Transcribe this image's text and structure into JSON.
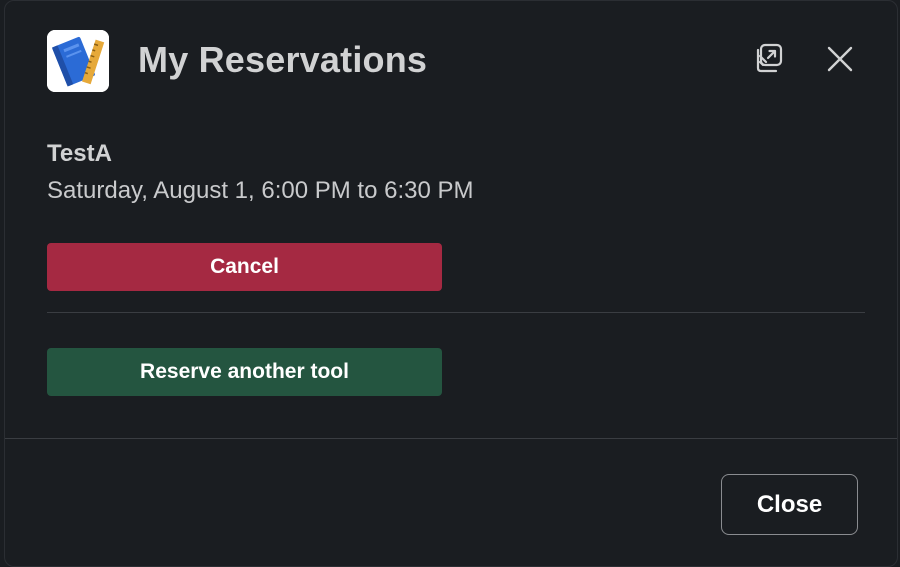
{
  "modal": {
    "title": "My Reservations",
    "icons": {
      "app": "notebook-ruler-icon",
      "popout": "popout-window-icon",
      "close": "close-icon"
    }
  },
  "reservation": {
    "name": "TestA",
    "time": "Saturday, August 1, 6:00 PM to 6:30 PM",
    "cancel_label": "Cancel"
  },
  "actions": {
    "reserve_label": "Reserve another tool"
  },
  "footer": {
    "close_label": "Close"
  },
  "colors": {
    "background": "#1a1d21",
    "cancel_button": "#a52942",
    "reserve_button": "#245540",
    "text": "#d1d2d3"
  }
}
